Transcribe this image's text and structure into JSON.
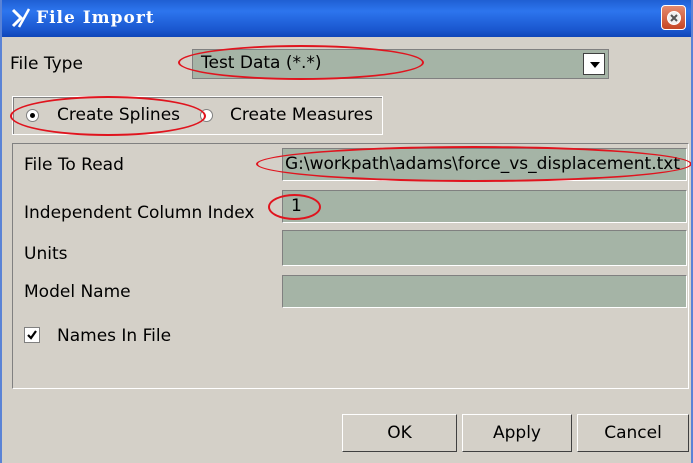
{
  "window": {
    "title": "File Import"
  },
  "file_type": {
    "label": "File Type",
    "value": "Test Data (*.*)"
  },
  "radio_options": [
    {
      "label": "Create Splines",
      "selected": true
    },
    {
      "label": "Create Measures",
      "selected": false
    }
  ],
  "fields": {
    "file_to_read": {
      "label": "File To Read",
      "value": "G:\\workpath\\adams\\force_vs_displacement.txt"
    },
    "independent_column_index": {
      "label": "Independent Column Index",
      "value": "1"
    },
    "units": {
      "label": "Units",
      "value": ""
    },
    "model_name": {
      "label": "Model Name",
      "value": ""
    }
  },
  "names_in_file": {
    "label": "Names In File",
    "checked": true
  },
  "buttons": {
    "ok": "OK",
    "apply": "Apply",
    "cancel": "Cancel"
  },
  "colors": {
    "field_bg": "#a5b4a6",
    "dialog_bg": "#d4d0c8",
    "title_blue": "#1f5fd3",
    "annotation_red": "#e0141e"
  }
}
